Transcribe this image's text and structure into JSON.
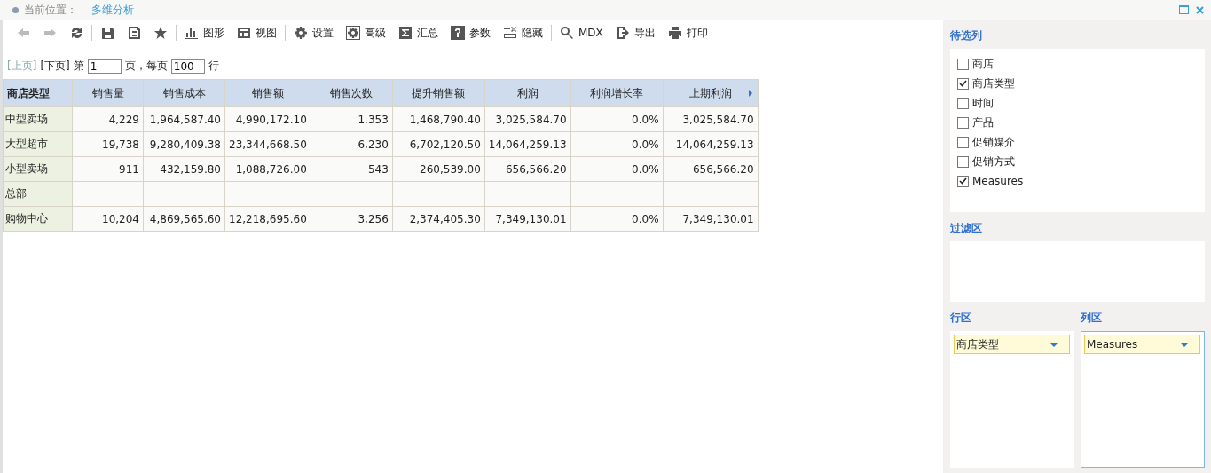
{
  "breadcrumb": {
    "label": "当前位置：",
    "current": "多维分析"
  },
  "toolbar": [
    {
      "kind": "back",
      "disabled": true
    },
    {
      "kind": "forward",
      "disabled": true
    },
    {
      "kind": "refresh",
      "disabled": false
    },
    {
      "kind": "sep"
    },
    {
      "kind": "save",
      "disabled": false
    },
    {
      "kind": "saveas",
      "disabled": false
    },
    {
      "kind": "star",
      "disabled": false
    },
    {
      "kind": "sep"
    },
    {
      "kind": "chart",
      "label": "图形",
      "disabled": false
    },
    {
      "kind": "view",
      "label": "视图",
      "disabled": false
    },
    {
      "kind": "sep"
    },
    {
      "kind": "gear",
      "label": "设置",
      "disabled": false
    },
    {
      "kind": "gear2",
      "label": "高级",
      "disabled": false
    },
    {
      "kind": "sigma",
      "label": "汇总",
      "disabled": false
    },
    {
      "kind": "question",
      "label": "参数",
      "disabled": false
    },
    {
      "kind": "hide",
      "label": "隐藏",
      "disabled": false
    },
    {
      "kind": "sep"
    },
    {
      "kind": "search",
      "label": "MDX",
      "disabled": false
    },
    {
      "kind": "export",
      "label": "导出",
      "disabled": false
    },
    {
      "kind": "print",
      "label": "打印",
      "disabled": false
    }
  ],
  "pager": {
    "prev": {
      "label": "[上页]",
      "disabled": true
    },
    "next": {
      "label": "[下页]",
      "disabled": false
    },
    "page_prefix": "第",
    "page": "1",
    "page_suffix": "页，每页",
    "per_page": "100",
    "per_page_suffix": "行"
  },
  "table": {
    "columns": [
      "商店类型",
      "销售量",
      "销售成本",
      "销售额",
      "销售次数",
      "提升销售额",
      "利润",
      "利润增长率",
      "上期利润"
    ],
    "rows": [
      [
        "中型卖场",
        "4,229",
        "1,964,587.40",
        "4,990,172.10",
        "1,353",
        "1,468,790.40",
        "3,025,584.70",
        "0.0%",
        "3,025,584.70"
      ],
      [
        "大型超市",
        "19,738",
        "9,280,409.38",
        "23,344,668.50",
        "6,230",
        "6,702,120.50",
        "14,064,259.13",
        "0.0%",
        "14,064,259.13"
      ],
      [
        "小型卖场",
        "911",
        "432,159.80",
        "1,088,726.00",
        "543",
        "260,539.00",
        "656,566.20",
        "0.0%",
        "656,566.20"
      ],
      [
        "总部",
        "",
        "",
        "",
        "",
        "",
        "",
        "",
        ""
      ],
      [
        "购物中心",
        "10,204",
        "4,869,565.60",
        "12,218,695.60",
        "3,256",
        "2,374,405.30",
        "7,349,130.01",
        "0.0%",
        "7,349,130.01"
      ]
    ]
  },
  "candidates": {
    "title": "待选列",
    "items": [
      {
        "label": "商店",
        "checked": false
      },
      {
        "label": "商店类型",
        "checked": true
      },
      {
        "label": "时间",
        "checked": false
      },
      {
        "label": "产品",
        "checked": false
      },
      {
        "label": "促销媒介",
        "checked": false
      },
      {
        "label": "促销方式",
        "checked": false
      },
      {
        "label": "Measures",
        "checked": true
      }
    ]
  },
  "filter": {
    "title": "过滤区"
  },
  "rows_area": {
    "title": "行区",
    "fields": [
      "商店类型"
    ],
    "selected": false
  },
  "cols_area": {
    "title": "列区",
    "fields": [
      "Measures"
    ],
    "selected": true
  }
}
